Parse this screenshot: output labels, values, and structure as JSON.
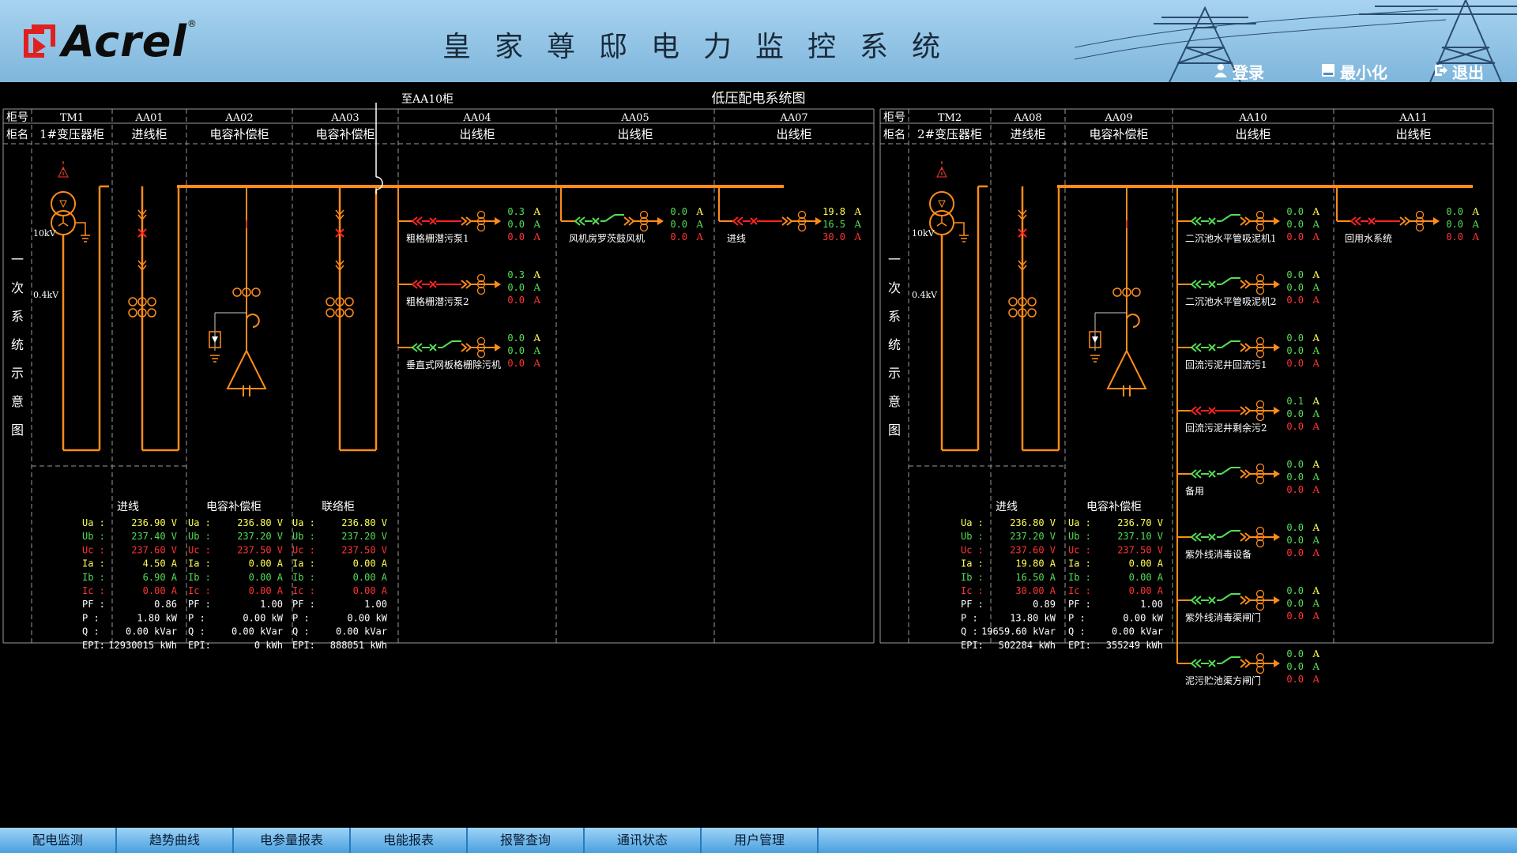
{
  "header": {
    "logo_text": "Acrel",
    "title": "皇家尊邸电力监控系统",
    "login_label": "登录",
    "minimize_label": "最小化",
    "exit_label": "退出"
  },
  "diagram": {
    "title": "低压配电系统图",
    "to_aa10": "至AA10柜",
    "row_no_label": "柜号",
    "row_name_label": "柜名",
    "side_label": [
      "一",
      "次",
      "系",
      "统",
      "示",
      "意",
      "图"
    ],
    "left_cabinets": [
      {
        "no": "TM1",
        "name": "1#变压器柜"
      },
      {
        "no": "AA01",
        "name": "进线柜"
      },
      {
        "no": "AA02",
        "name": "电容补偿柜"
      },
      {
        "no": "AA03",
        "name": "电容补偿柜"
      },
      {
        "no": "AA04",
        "name": "出线柜"
      },
      {
        "no": "AA05",
        "name": "出线柜"
      },
      {
        "no": "AA07",
        "name": "出线柜"
      }
    ],
    "right_cabinets": [
      {
        "no": "TM2",
        "name": "2#变压器柜"
      },
      {
        "no": "AA08",
        "name": "进线柜"
      },
      {
        "no": "AA09",
        "name": "电容补偿柜"
      },
      {
        "no": "AA10",
        "name": "出线柜"
      },
      {
        "no": "AA11",
        "name": "出线柜"
      }
    ],
    "hv_label": "10kV",
    "lv_label": "0.4kV",
    "left_feeders": [
      {
        "name": "粗格栅潜污泵1",
        "state": "off",
        "a": "0.3",
        "b": "0.0",
        "c": "0.0"
      },
      {
        "name": "粗格栅潜污泵2",
        "state": "off",
        "a": "0.3",
        "b": "0.0",
        "c": "0.0"
      },
      {
        "name": "垂直式网板格栅除污机",
        "state": "on",
        "a": "0.0",
        "b": "0.0",
        "c": "0.0"
      },
      {
        "name": "风机房罗茨鼓风机",
        "state": "on",
        "a": "0.0",
        "b": "0.0",
        "c": "0.0"
      },
      {
        "name": "进线",
        "state": "off",
        "a": "19.8",
        "b": "16.5",
        "c": "30.0"
      }
    ],
    "right_feeders": [
      {
        "name": "二沉池水平管吸泥机1",
        "state": "on",
        "a": "0.0",
        "b": "0.0",
        "c": "0.0"
      },
      {
        "name": "二沉池水平管吸泥机2",
        "state": "on",
        "a": "0.0",
        "b": "0.0",
        "c": "0.0"
      },
      {
        "name": "回流污泥井回流污1",
        "state": "on",
        "a": "0.0",
        "b": "0.0",
        "c": "0.0"
      },
      {
        "name": "回流污泥井剩余污2",
        "state": "off",
        "a": "0.1",
        "b": "0.0",
        "c": "0.0"
      },
      {
        "name": "备用",
        "state": "on",
        "a": "0.0",
        "b": "0.0",
        "c": "0.0"
      },
      {
        "name": "紫外线消毒设备",
        "state": "on",
        "a": "0.0",
        "b": "0.0",
        "c": "0.0"
      },
      {
        "name": "紫外线消毒渠闸门",
        "state": "on",
        "a": "0.0",
        "b": "0.0",
        "c": "0.0"
      },
      {
        "name": "泥污贮池渠方闸门",
        "state": "on",
        "a": "0.0",
        "b": "0.0",
        "c": "0.0"
      },
      {
        "name": "回用水系统",
        "state": "off",
        "a": "0.0",
        "b": "0.0",
        "c": "0.0"
      }
    ],
    "unit_amp": "A",
    "meas_labels": [
      "Ua :",
      "Ub :",
      "Uc :",
      "Ia :",
      "Ib :",
      "Ic :",
      "PF :",
      "P  :",
      "Q  :",
      "EPI:"
    ],
    "meas_colors": [
      "#ffff55",
      "#55dd55",
      "#ff3333",
      "#ffff55",
      "#55dd55",
      "#ff3333",
      "#ffffff",
      "#ffffff",
      "#ffffff",
      "#ffffff"
    ],
    "left_meas": [
      {
        "title": "进线",
        "values": [
          "236.90 V",
          "237.40 V",
          "237.60 V",
          "4.50 A",
          "6.90 A",
          "0.00 A",
          "0.86",
          "1.80 kW",
          "0.00 kVar",
          "12930015 kWh"
        ]
      },
      {
        "title": "电容补偿柜",
        "values": [
          "236.80 V",
          "237.20 V",
          "237.50 V",
          "0.00 A",
          "0.00 A",
          "0.00 A",
          "1.00",
          "0.00 kW",
          "0.00 kVar",
          "0 kWh"
        ]
      },
      {
        "title": "联络柜",
        "values": [
          "236.80 V",
          "237.20 V",
          "237.50 V",
          "0.00 A",
          "0.00 A",
          "0.00 A",
          "1.00",
          "0.00 kW",
          "0.00 kVar",
          "888051 kWh"
        ]
      }
    ],
    "right_meas": [
      {
        "title": "进线",
        "values": [
          "236.80 V",
          "237.20 V",
          "237.60 V",
          "19.80 A",
          "16.50 A",
          "30.00 A",
          "0.89",
          "13.80 kW",
          "19659.60 kVar",
          "502284 kWh"
        ]
      },
      {
        "title": "电容补偿柜",
        "values": [
          "236.70 V",
          "237.10 V",
          "237.50 V",
          "0.00 A",
          "0.00 A",
          "0.00 A",
          "1.00",
          "0.00 kW",
          "0.00 kVar",
          "355249 kWh"
        ]
      }
    ]
  },
  "nav_tabs": [
    "配电监测",
    "趋势曲线",
    "电参量报表",
    "电能报表",
    "报警查询",
    "通讯状态",
    "用户管理"
  ],
  "colors": {
    "bus": "#ff8c1a",
    "closed": "#55dd55",
    "open": "#ff2222",
    "grid": "#9a9a9a"
  }
}
